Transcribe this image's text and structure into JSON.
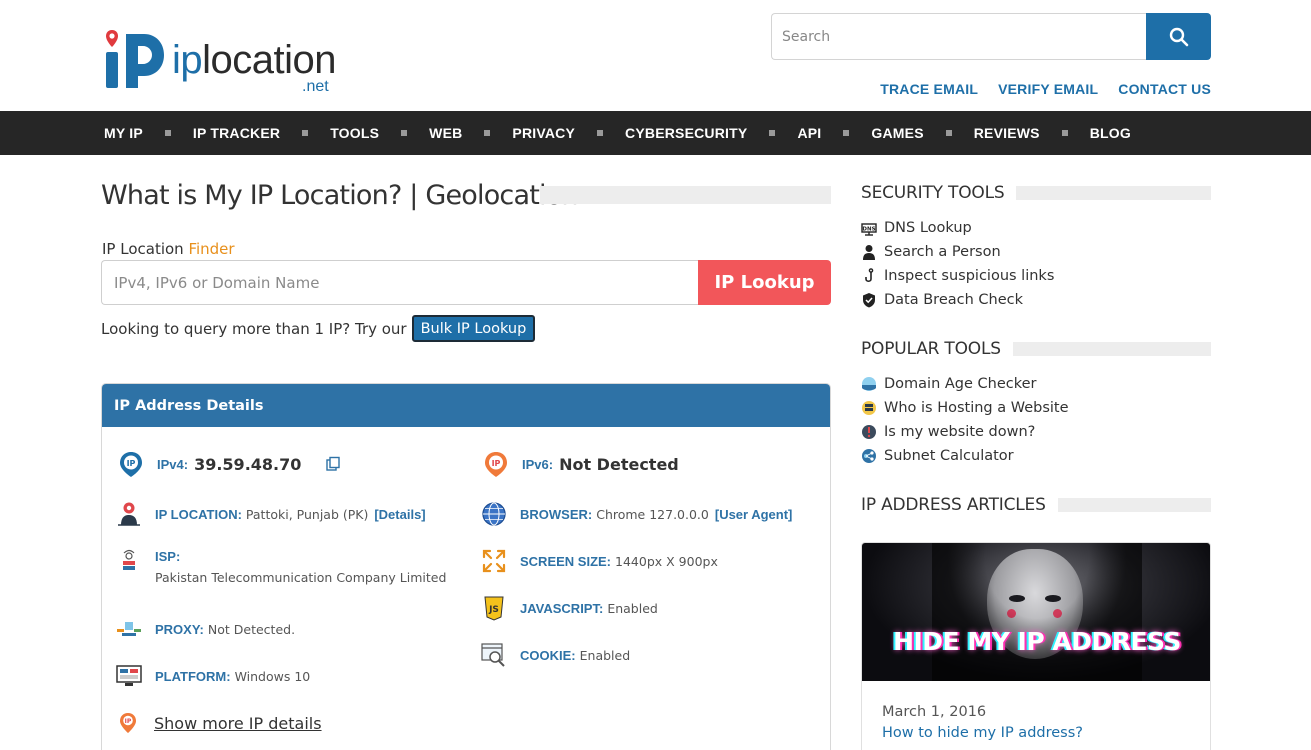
{
  "header": {
    "logo_text_i": "ip",
    "logo_text_rest": "location",
    "logo_net": ".net",
    "search_placeholder": "Search",
    "top_links": [
      "TRACE EMAIL",
      "VERIFY EMAIL",
      "CONTACT US"
    ]
  },
  "nav": [
    "MY IP",
    "IP TRACKER",
    "TOOLS",
    "WEB",
    "PRIVACY",
    "CYBERSECURITY",
    "API",
    "GAMES",
    "REVIEWS",
    "BLOG"
  ],
  "main": {
    "title": "What is My IP Location? | Geolocation",
    "finder_label": "IP Location ",
    "finder_accent": "Finder",
    "lookup_placeholder": "IPv4, IPv6 or Domain Name",
    "lookup_button": "IP Lookup",
    "bulk_text": "Looking to query more than 1 IP? Try our",
    "bulk_button": "Bulk IP Lookup"
  },
  "card": {
    "title": "IP Address Details",
    "ipv4_label": "IPv4:",
    "ipv4_value": "39.59.48.70",
    "ipv6_label": "IPv6:",
    "ipv6_value": "Not Detected",
    "location_label": "IP LOCATION:",
    "location_value": "Pattoki, Punjab (PK)",
    "location_link": "[Details]",
    "browser_label": "BROWSER:",
    "browser_value": "Chrome 127.0.0.0",
    "browser_link": "[User Agent]",
    "isp_label": "ISP:",
    "isp_value": "Pakistan Telecommunication Company Limited",
    "screen_label": "SCREEN SIZE:",
    "screen_value": "1440px X 900px",
    "javascript_label": "JAVASCRIPT:",
    "javascript_value": "Enabled",
    "proxy_label": "PROXY:",
    "proxy_value": "Not Detected.",
    "cookie_label": "COOKIE:",
    "cookie_value": "Enabled",
    "platform_label": "PLATFORM:",
    "platform_value": "Windows 10",
    "show_more": "Show more IP details"
  },
  "sidebar": {
    "security_title": "SECURITY TOOLS",
    "security_items": [
      "DNS Lookup",
      "Search a Person",
      "Inspect suspicious links",
      "Data Breach Check"
    ],
    "popular_title": "POPULAR TOOLS",
    "popular_items": [
      "Domain Age Checker",
      "Who is Hosting a Website",
      "Is my website down?",
      "Subnet Calculator"
    ],
    "articles_title": "IP ADDRESS ARTICLES",
    "article_image_text": "HIDE MY IP ADDRESS",
    "article_date": "March 1, 2016",
    "article_link": "How to hide my IP address?"
  },
  "colors": {
    "brand_blue": "#1e6fa8",
    "card_header": "#2e72a6",
    "lookup_red": "#f2565a",
    "accent_orange": "#e8901c",
    "nav_bg": "#262626"
  }
}
